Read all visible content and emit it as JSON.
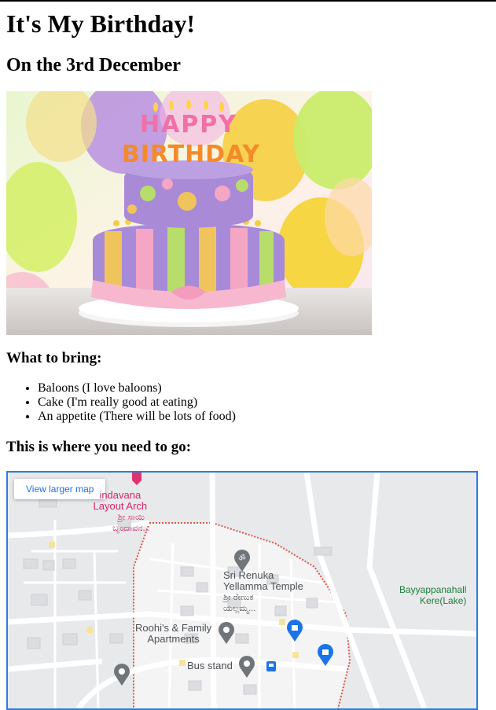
{
  "page": {
    "title": "It's My Birthday!",
    "subtitle": "On the 3rd December",
    "cake_image": {
      "topper_line1": "HAPPY",
      "topper_line2": "BIRTHDAY"
    },
    "bring_heading": "What to bring:",
    "bring_items": [
      "Baloons (I love baloons)",
      "Cake (I'm really good at eating)",
      "An appetite (There will be lots of food)"
    ],
    "where_heading": "This is where you need to go:"
  },
  "map": {
    "view_larger": "View larger map",
    "labels": {
      "arch_line1": "indavana",
      "arch_line2": "Layout Arch",
      "arch_kannada1": "ಶ್ರೀ ಸಾಯಿ",
      "arch_kannada2": "ಬೃಂದಾವನ...",
      "temple_line1": "Sri Renuka",
      "temple_line2": "Yellamma Temple",
      "temple_kannada1": "ಶ್ರೀ ರೇಣುಕ",
      "temple_kannada2": "ಯಲ್ಲಮ್ಮ...",
      "lake_line1": "Bayyappanahall",
      "lake_line2": "Kere(Lake)",
      "apartments_line1": "Roohi's & Family",
      "apartments_line2": "Apartments",
      "bus_stand": "Bus stand"
    },
    "colors": {
      "border": "#2f7be0",
      "pink_pin": "#e0326f",
      "grey_pin": "#707579",
      "blue_pin": "#1a73e8"
    }
  }
}
